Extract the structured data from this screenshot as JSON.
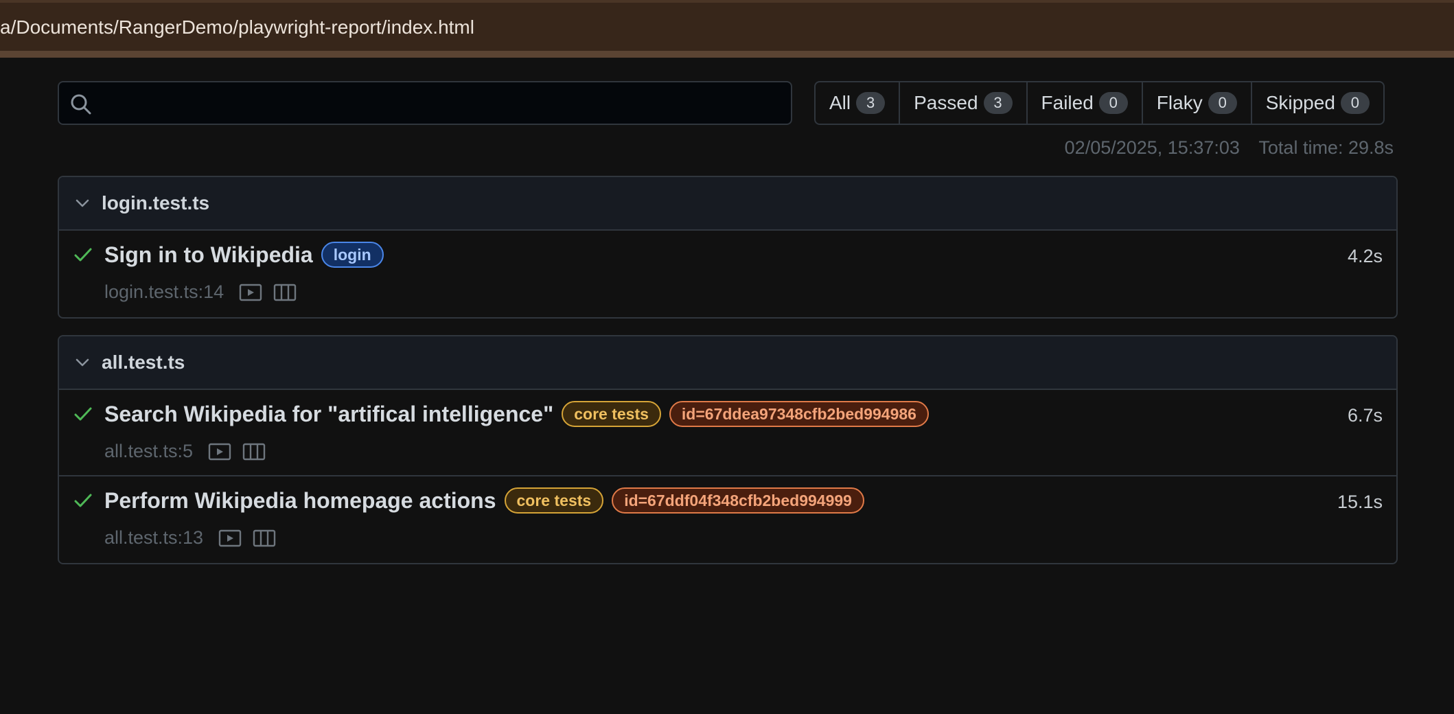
{
  "browser": {
    "url": "a/Documents/RangerDemo/playwright-report/index.html"
  },
  "search": {
    "placeholder": "",
    "icon": "search-icon"
  },
  "filters": [
    {
      "label": "All",
      "count": "3"
    },
    {
      "label": "Passed",
      "count": "3"
    },
    {
      "label": "Failed",
      "count": "0"
    },
    {
      "label": "Flaky",
      "count": "0"
    },
    {
      "label": "Skipped",
      "count": "0"
    }
  ],
  "meta": {
    "timestamp": "02/05/2025, 15:37:03",
    "total_time": "Total time: 29.8s"
  },
  "files": [
    {
      "name": "login.test.ts",
      "tests": [
        {
          "title": "Sign in to Wikipedia",
          "status": "passed",
          "duration": "4.2s",
          "location": "login.test.ts:14",
          "tags": [
            {
              "text": "login",
              "color": "blue"
            }
          ]
        }
      ]
    },
    {
      "name": "all.test.ts",
      "tests": [
        {
          "title": "Search Wikipedia for \"artifical intelligence\"",
          "status": "passed",
          "duration": "6.7s",
          "location": "all.test.ts:5",
          "tags": [
            {
              "text": "core tests",
              "color": "yellow"
            },
            {
              "text": "id=67ddea97348cfb2bed994986",
              "color": "orange"
            }
          ]
        },
        {
          "title": "Perform Wikipedia homepage actions",
          "status": "passed",
          "duration": "15.1s",
          "location": "all.test.ts:13",
          "tags": [
            {
              "text": "core tests",
              "color": "yellow"
            },
            {
              "text": "id=67ddf04f348cfb2bed994999",
              "color": "orange"
            }
          ]
        }
      ]
    }
  ],
  "colors": {
    "background": "#111111",
    "url_bar": "#37261a",
    "pass_check": "#4fb957",
    "tag_blue": "#4a86e8",
    "tag_yellow": "#d6a437",
    "tag_orange": "#e07a48"
  }
}
